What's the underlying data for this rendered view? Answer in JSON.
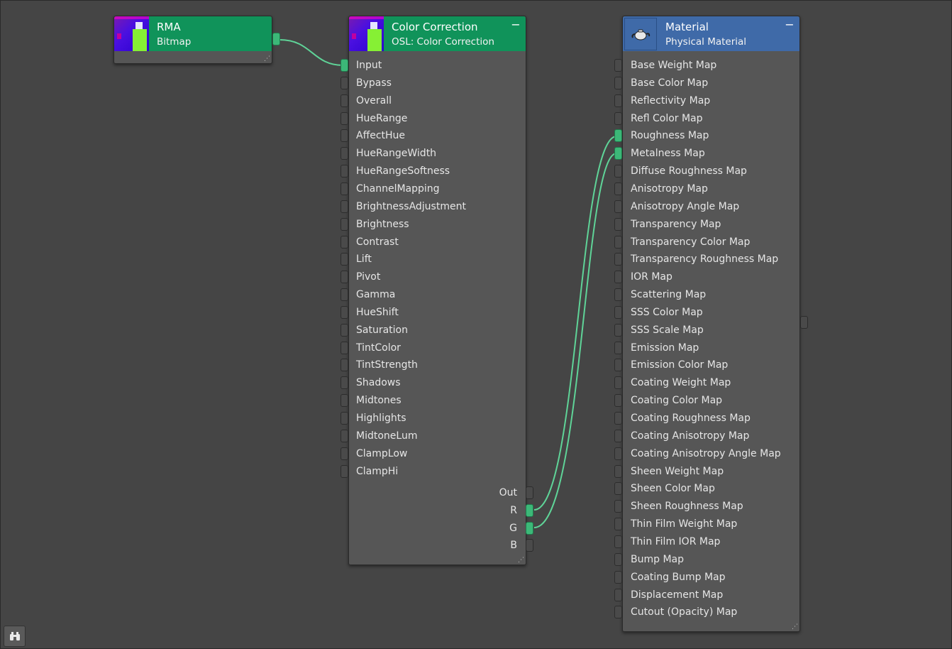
{
  "nodes": {
    "rma": {
      "title": "RMA",
      "subtitle": "Bitmap"
    },
    "color_correction": {
      "title": "Color Correction",
      "subtitle": "OSL: Color Correction",
      "minimize": "−",
      "inputs": [
        "Input",
        "Bypass",
        "Overall",
        "HueRange",
        "AffectHue",
        "HueRangeWidth",
        "HueRangeSoftness",
        "ChannelMapping",
        "BrightnessAdjustment",
        "Brightness",
        "Contrast",
        "Lift",
        "Pivot",
        "Gamma",
        "HueShift",
        "Saturation",
        "TintColor",
        "TintStrength",
        "Shadows",
        "Midtones",
        "Highlights",
        "MidtoneLum",
        "ClampLow",
        "ClampHi"
      ],
      "outputs": [
        "Out",
        "R",
        "G",
        "B"
      ]
    },
    "material": {
      "title": "Material",
      "subtitle": "Physical Material",
      "minimize": "−",
      "inputs": [
        "Base Weight Map",
        "Base Color Map",
        "Reflectivity Map",
        "Refl Color Map",
        "Roughness Map",
        "Metalness Map",
        "Diffuse Roughness Map",
        "Anisotropy Map",
        "Anisotropy Angle Map",
        "Transparency Map",
        "Transparency Color Map",
        "Transparency Roughness Map",
        "IOR Map",
        "Scattering Map",
        "SSS Color Map",
        "SSS Scale Map",
        "Emission Map",
        "Emission Color Map",
        "Coating Weight Map",
        "Coating Color Map",
        "Coating Roughness Map",
        "Coating Anisotropy Map",
        "Coating Anisotropy Angle Map",
        "Sheen Weight Map",
        "Sheen Color Map",
        "Sheen Roughness Map",
        "Thin Film Weight Map",
        "Thin Film IOR Map",
        "Bump Map",
        "Coating Bump Map",
        "Displacement Map",
        "Cutout (Opacity) Map"
      ]
    }
  },
  "connections": [
    {
      "from": "RMA.output",
      "to": "Color Correction.Input"
    },
    {
      "from": "Color Correction.R",
      "to": "Material.Roughness Map"
    },
    {
      "from": "Color Correction.G",
      "to": "Material.Metalness Map"
    }
  ],
  "colors": {
    "canvas": "#454545",
    "node_body": "#565656",
    "map_header": "#10935a",
    "material_header": "#3f6aa8",
    "wire": "#5fd498",
    "socket_connected": "#3cb878"
  },
  "icons": {
    "material": "teapot-icon",
    "bottom_tool": "binoculars-icon"
  }
}
